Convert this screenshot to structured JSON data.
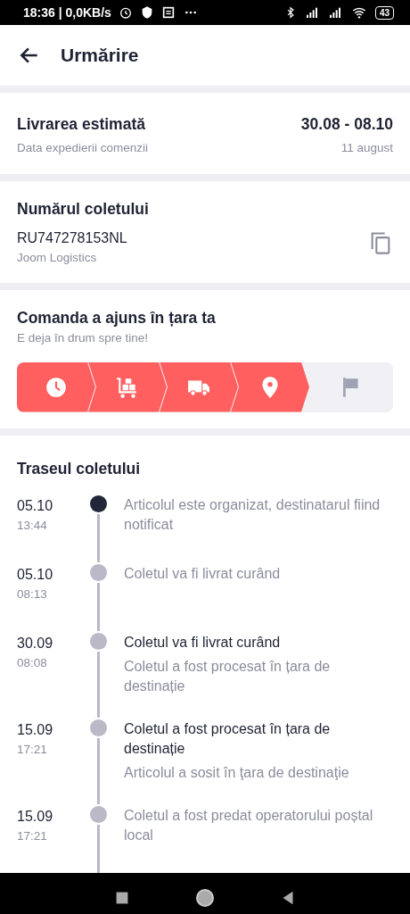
{
  "status_bar": {
    "time": "18:36 | 0,0KB/s",
    "battery": "43"
  },
  "header": {
    "title": "Urmărire"
  },
  "estimate": {
    "title": "Livrarea estimată",
    "subtitle": "Data expedierii comenzii",
    "range": "30.08 - 08.10",
    "date": "11 august"
  },
  "parcel": {
    "title": "Numărul coletului",
    "number": "RU747278153NL",
    "carrier": "Joom Logistics"
  },
  "status": {
    "title": "Comanda a ajuns în țara ta",
    "subtitle": "E deja în drum spre tine!",
    "steps": [
      {
        "kind": "clock",
        "done": true
      },
      {
        "kind": "cart",
        "done": true
      },
      {
        "kind": "truck",
        "done": true
      },
      {
        "kind": "pin",
        "done": true
      },
      {
        "kind": "flag",
        "done": false
      }
    ]
  },
  "route": {
    "title": "Traseul coletului",
    "events": [
      {
        "date": "05.10",
        "time": "13:44",
        "description": "Articolul este organizat, destinatarul fiind notificat",
        "current": true
      },
      {
        "date": "05.10",
        "time": "08:13",
        "description": "Coletul va fi livrat curând",
        "current": false
      },
      {
        "date": "30.09",
        "time": "08:08",
        "title": "Coletul va fi livrat curând",
        "description": "Coletul a fost procesat în țara de destinație",
        "current": false
      },
      {
        "date": "15.09",
        "time": "17:21",
        "title": "Coletul a fost procesat în țara de destinație",
        "description": "Articolul a sosit în ţara de destinaţie",
        "current": false
      },
      {
        "date": "15.09",
        "time": "17:21",
        "description": "Coletul a fost predat operatorului poștal local",
        "current": false
      }
    ]
  }
}
